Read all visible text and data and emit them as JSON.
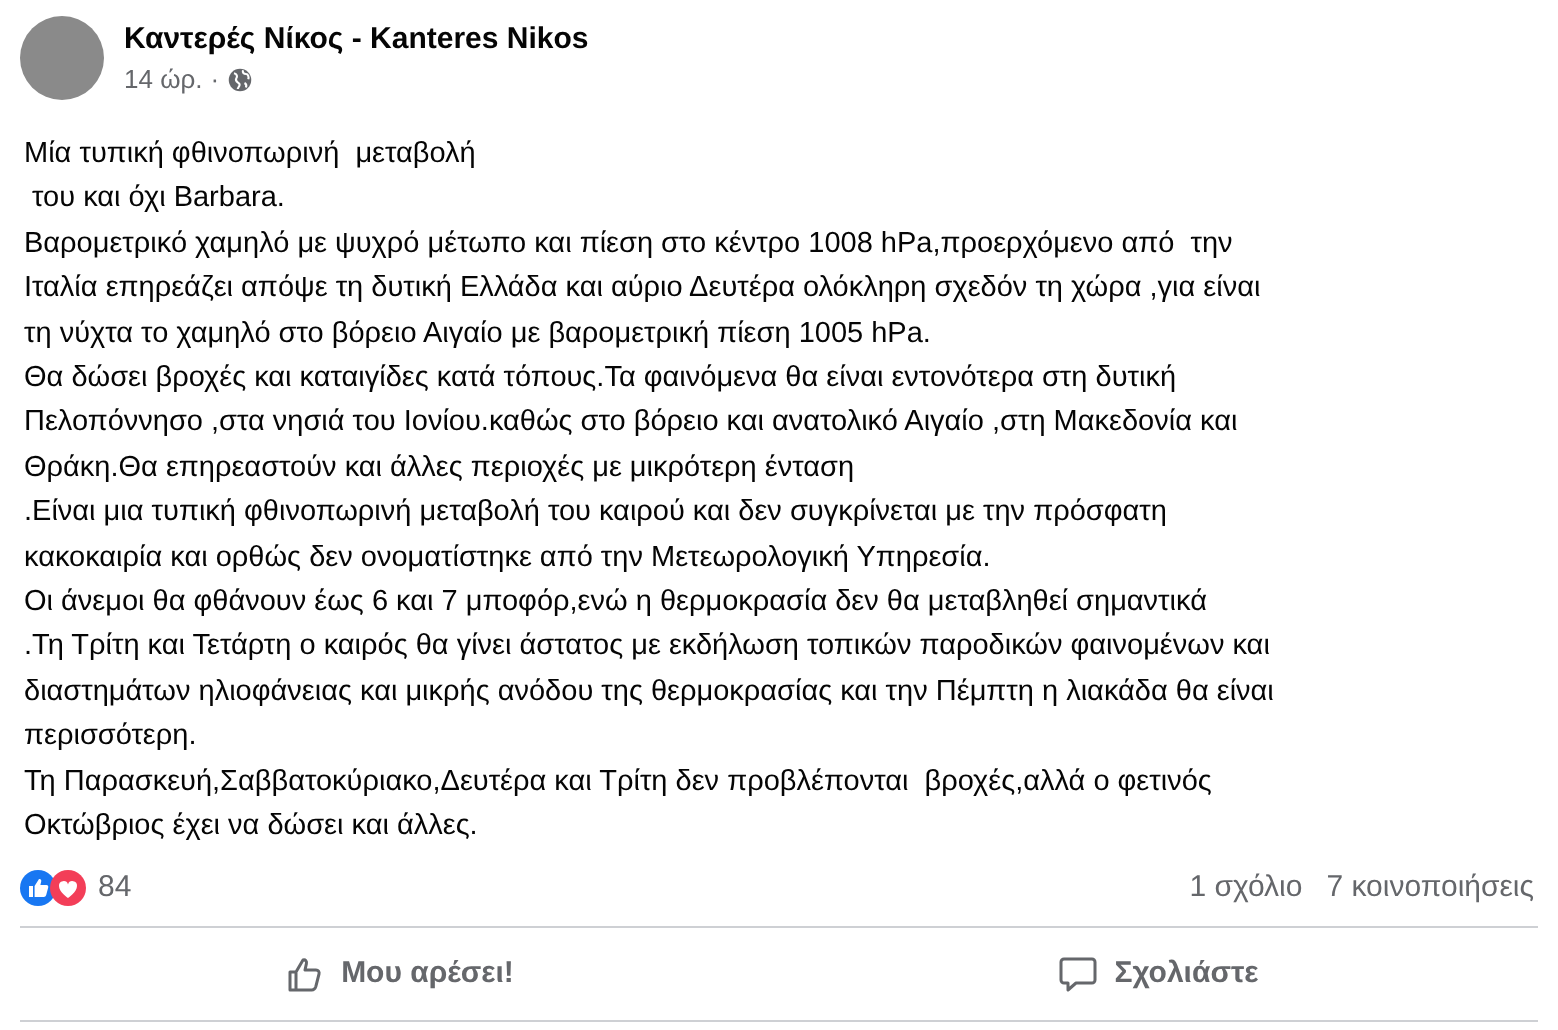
{
  "post": {
    "author": "Καντερές Νίκος - Kanteres Nikos",
    "time": "14 ώρ.",
    "separator": "·",
    "lines": [
      "Μία τυπική φθινοπωρινή  μεταβολή",
      " του και όχι Barbara.",
      "Βαρομετρικό χαμηλό με ψυχρό μέτωπο και πίεση στο κέντρο 1008 hPa,προερχόμενο από  την",
      "Ιταλία επηρεάζει απόψε τη δυτική Ελλάδα και αύριο Δευτέρα ολόκληρη σχεδόν τη χώρα ,για είναι",
      "τη νύχτα το χαμηλό στο βόρειο Αιγαίο με βαρομετρική πίεση 1005 hPa.",
      "Θα δώσει βροχές και καταιγίδες κατά τόπους.Τα φαινόμενα θα είναι εντονότερα στη δυτική",
      "Πελοπόννησο ,στα νησιά του Ιονίου.καθώς στο βόρειο και ανατολικό Αιγαίο ,στη Μακεδονία και",
      "Θράκη.Θα επηρεαστούν και άλλες περιοχές με μικρότερη ένταση",
      ".Είναι μια τυπική φθινοπωρινή μεταβολή του καιρού και δεν συγκρίνεται με την πρόσφατη",
      "κακοκαιρία και ορθώς δεν ονοματίστηκε από την Μετεωρολογική Υπηρεσία.",
      "Οι άνεμοι θα φθάνουν έως 6 και 7 μποφόρ,ενώ η θερμοκρασία δεν θα μεταβληθεί σημαντικά",
      ".Τη Τρίτη και Τετάρτη ο καιρός θα γίνει άστατος με εκδήλωση τοπικών παροδικών φαινομένων και",
      "διαστημάτων ηλιοφάνειας και μικρής ανόδου της θερμοκρασίας και την Πέμπτη η λιακάδα θα είναι",
      "περισσότερη.",
      "Τη Παρασκευή,Σαββατοκύριακο,Δευτέρα και Τρίτη δεν προβλέπονται  βροχές,αλλά ο φετινός",
      "Οκτώβριος έχει να δώσει και άλλες."
    ],
    "reaction_count": "84",
    "comments": "1 σχόλιο",
    "shares": "7 κοινοποιήσεις",
    "actions": [
      {
        "kind": "like",
        "label": "Μου αρέσει!"
      },
      {
        "kind": "comment",
        "label": "Σχολιάστε"
      }
    ]
  }
}
